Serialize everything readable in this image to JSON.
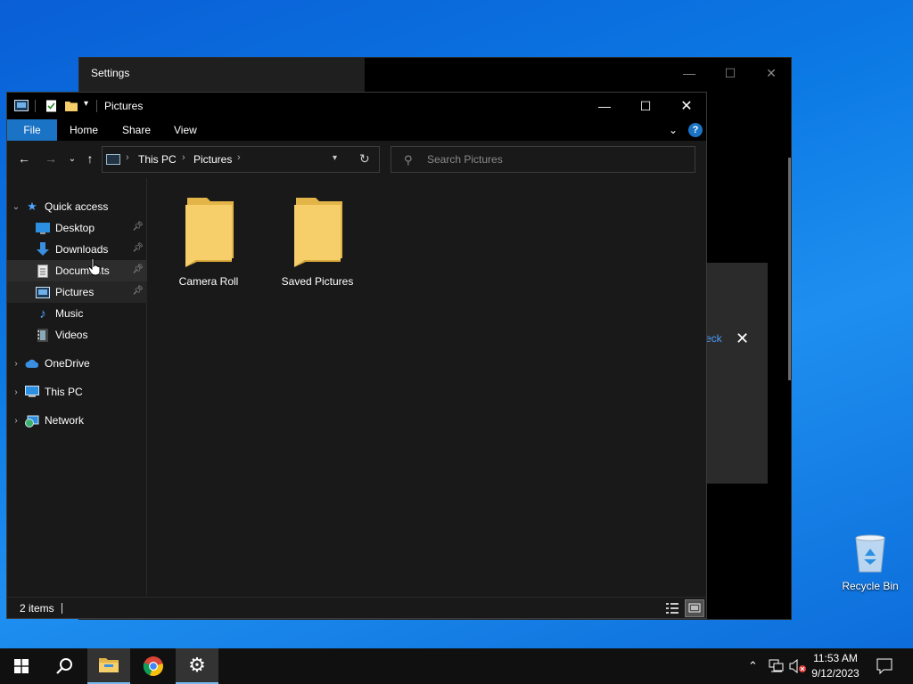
{
  "settings": {
    "title": "Settings",
    "panel_link": "eck",
    "controls": {
      "minimize": "—",
      "maximize": "☐",
      "close": "✕"
    }
  },
  "explorer": {
    "title": "Pictures",
    "ribbon": {
      "file": "File",
      "home": "Home",
      "share": "Share",
      "view": "View",
      "help": "?"
    },
    "address": {
      "crumbs": [
        "This PC",
        "Pictures"
      ]
    },
    "search": {
      "placeholder": "Search Pictures"
    },
    "sidebar": {
      "quick_access": "Quick access",
      "items": [
        {
          "label": "Desktop",
          "pinned": true
        },
        {
          "label": "Downloads",
          "pinned": true
        },
        {
          "label": "Documents",
          "pinned": true
        },
        {
          "label": "Pictures",
          "pinned": true
        },
        {
          "label": "Music",
          "pinned": false
        },
        {
          "label": "Videos",
          "pinned": false
        }
      ],
      "onedrive": "OneDrive",
      "this_pc": "This PC",
      "network": "Network"
    },
    "folders": [
      {
        "label": "Camera Roll"
      },
      {
        "label": "Saved Pictures"
      }
    ],
    "status": {
      "count": "2 items"
    }
  },
  "desktop": {
    "recycle_bin": "Recycle Bin"
  },
  "taskbar": {
    "time": "11:53 AM",
    "date": "9/12/2023"
  },
  "colors": {
    "accent": "#1a73c4",
    "folder": "#f6cf6a",
    "folder_dark": "#e3b548"
  }
}
